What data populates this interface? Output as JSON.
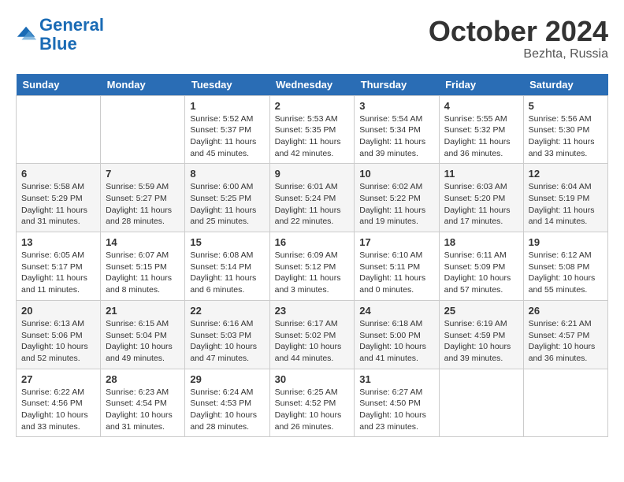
{
  "header": {
    "logo_line1": "General",
    "logo_line2": "Blue",
    "month": "October 2024",
    "location": "Bezhta, Russia"
  },
  "weekdays": [
    "Sunday",
    "Monday",
    "Tuesday",
    "Wednesday",
    "Thursday",
    "Friday",
    "Saturday"
  ],
  "weeks": [
    [
      {
        "day": "",
        "info": ""
      },
      {
        "day": "",
        "info": ""
      },
      {
        "day": "1",
        "info": "Sunrise: 5:52 AM\nSunset: 5:37 PM\nDaylight: 11 hours and 45 minutes."
      },
      {
        "day": "2",
        "info": "Sunrise: 5:53 AM\nSunset: 5:35 PM\nDaylight: 11 hours and 42 minutes."
      },
      {
        "day": "3",
        "info": "Sunrise: 5:54 AM\nSunset: 5:34 PM\nDaylight: 11 hours and 39 minutes."
      },
      {
        "day": "4",
        "info": "Sunrise: 5:55 AM\nSunset: 5:32 PM\nDaylight: 11 hours and 36 minutes."
      },
      {
        "day": "5",
        "info": "Sunrise: 5:56 AM\nSunset: 5:30 PM\nDaylight: 11 hours and 33 minutes."
      }
    ],
    [
      {
        "day": "6",
        "info": "Sunrise: 5:58 AM\nSunset: 5:29 PM\nDaylight: 11 hours and 31 minutes."
      },
      {
        "day": "7",
        "info": "Sunrise: 5:59 AM\nSunset: 5:27 PM\nDaylight: 11 hours and 28 minutes."
      },
      {
        "day": "8",
        "info": "Sunrise: 6:00 AM\nSunset: 5:25 PM\nDaylight: 11 hours and 25 minutes."
      },
      {
        "day": "9",
        "info": "Sunrise: 6:01 AM\nSunset: 5:24 PM\nDaylight: 11 hours and 22 minutes."
      },
      {
        "day": "10",
        "info": "Sunrise: 6:02 AM\nSunset: 5:22 PM\nDaylight: 11 hours and 19 minutes."
      },
      {
        "day": "11",
        "info": "Sunrise: 6:03 AM\nSunset: 5:20 PM\nDaylight: 11 hours and 17 minutes."
      },
      {
        "day": "12",
        "info": "Sunrise: 6:04 AM\nSunset: 5:19 PM\nDaylight: 11 hours and 14 minutes."
      }
    ],
    [
      {
        "day": "13",
        "info": "Sunrise: 6:05 AM\nSunset: 5:17 PM\nDaylight: 11 hours and 11 minutes."
      },
      {
        "day": "14",
        "info": "Sunrise: 6:07 AM\nSunset: 5:15 PM\nDaylight: 11 hours and 8 minutes."
      },
      {
        "day": "15",
        "info": "Sunrise: 6:08 AM\nSunset: 5:14 PM\nDaylight: 11 hours and 6 minutes."
      },
      {
        "day": "16",
        "info": "Sunrise: 6:09 AM\nSunset: 5:12 PM\nDaylight: 11 hours and 3 minutes."
      },
      {
        "day": "17",
        "info": "Sunrise: 6:10 AM\nSunset: 5:11 PM\nDaylight: 11 hours and 0 minutes."
      },
      {
        "day": "18",
        "info": "Sunrise: 6:11 AM\nSunset: 5:09 PM\nDaylight: 10 hours and 57 minutes."
      },
      {
        "day": "19",
        "info": "Sunrise: 6:12 AM\nSunset: 5:08 PM\nDaylight: 10 hours and 55 minutes."
      }
    ],
    [
      {
        "day": "20",
        "info": "Sunrise: 6:13 AM\nSunset: 5:06 PM\nDaylight: 10 hours and 52 minutes."
      },
      {
        "day": "21",
        "info": "Sunrise: 6:15 AM\nSunset: 5:04 PM\nDaylight: 10 hours and 49 minutes."
      },
      {
        "day": "22",
        "info": "Sunrise: 6:16 AM\nSunset: 5:03 PM\nDaylight: 10 hours and 47 minutes."
      },
      {
        "day": "23",
        "info": "Sunrise: 6:17 AM\nSunset: 5:02 PM\nDaylight: 10 hours and 44 minutes."
      },
      {
        "day": "24",
        "info": "Sunrise: 6:18 AM\nSunset: 5:00 PM\nDaylight: 10 hours and 41 minutes."
      },
      {
        "day": "25",
        "info": "Sunrise: 6:19 AM\nSunset: 4:59 PM\nDaylight: 10 hours and 39 minutes."
      },
      {
        "day": "26",
        "info": "Sunrise: 6:21 AM\nSunset: 4:57 PM\nDaylight: 10 hours and 36 minutes."
      }
    ],
    [
      {
        "day": "27",
        "info": "Sunrise: 6:22 AM\nSunset: 4:56 PM\nDaylight: 10 hours and 33 minutes."
      },
      {
        "day": "28",
        "info": "Sunrise: 6:23 AM\nSunset: 4:54 PM\nDaylight: 10 hours and 31 minutes."
      },
      {
        "day": "29",
        "info": "Sunrise: 6:24 AM\nSunset: 4:53 PM\nDaylight: 10 hours and 28 minutes."
      },
      {
        "day": "30",
        "info": "Sunrise: 6:25 AM\nSunset: 4:52 PM\nDaylight: 10 hours and 26 minutes."
      },
      {
        "day": "31",
        "info": "Sunrise: 6:27 AM\nSunset: 4:50 PM\nDaylight: 10 hours and 23 minutes."
      },
      {
        "day": "",
        "info": ""
      },
      {
        "day": "",
        "info": ""
      }
    ]
  ]
}
